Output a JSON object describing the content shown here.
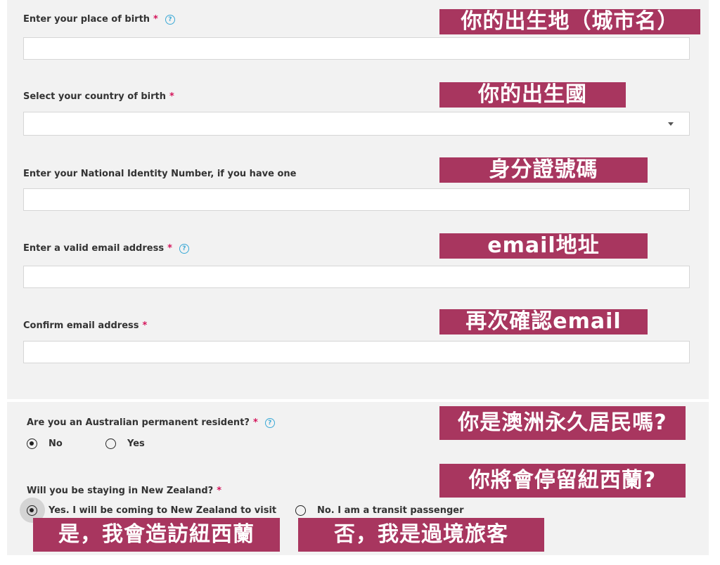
{
  "fields": {
    "place_of_birth": {
      "label": "Enter your place of birth",
      "required": "*",
      "help": "?",
      "value": ""
    },
    "country_of_birth": {
      "label": "Select your country of birth",
      "required": "*",
      "value": ""
    },
    "national_id": {
      "label": "Enter your National Identity Number, if you have one",
      "value": ""
    },
    "email": {
      "label": "Enter a valid email address",
      "required": "*",
      "help": "?",
      "value": ""
    },
    "confirm_email": {
      "label": "Confirm email address",
      "required": "*",
      "value": ""
    }
  },
  "australian_pr": {
    "question": "Are you an Australian permanent resident?",
    "required": "*",
    "help": "?",
    "options": [
      {
        "label": "No",
        "selected": true
      },
      {
        "label": "Yes",
        "selected": false
      }
    ]
  },
  "staying_nz": {
    "question": "Will you be staying in New Zealand?",
    "required": "*",
    "options": [
      {
        "label": "Yes. I will be coming to New Zealand to visit",
        "selected": true
      },
      {
        "label": "No. I am a transit passenger",
        "selected": false
      }
    ]
  },
  "annotations": {
    "place_of_birth": "你的出生地（城市名）",
    "country_of_birth": "你的出生國",
    "national_id": "身分證號碼",
    "email": "email地址",
    "confirm_email": "再次確認email",
    "australian_pr": "你是澳洲永久居民嗎?",
    "staying_nz": "你將會停留紐西蘭?",
    "staying_yes": "是，我會造訪紐西蘭",
    "staying_no": "否，我是過境旅客"
  },
  "colors": {
    "banner": "#a8365f",
    "required": "#d4145a",
    "help": "#3ba9d6",
    "panel": "#f2f2f2"
  }
}
